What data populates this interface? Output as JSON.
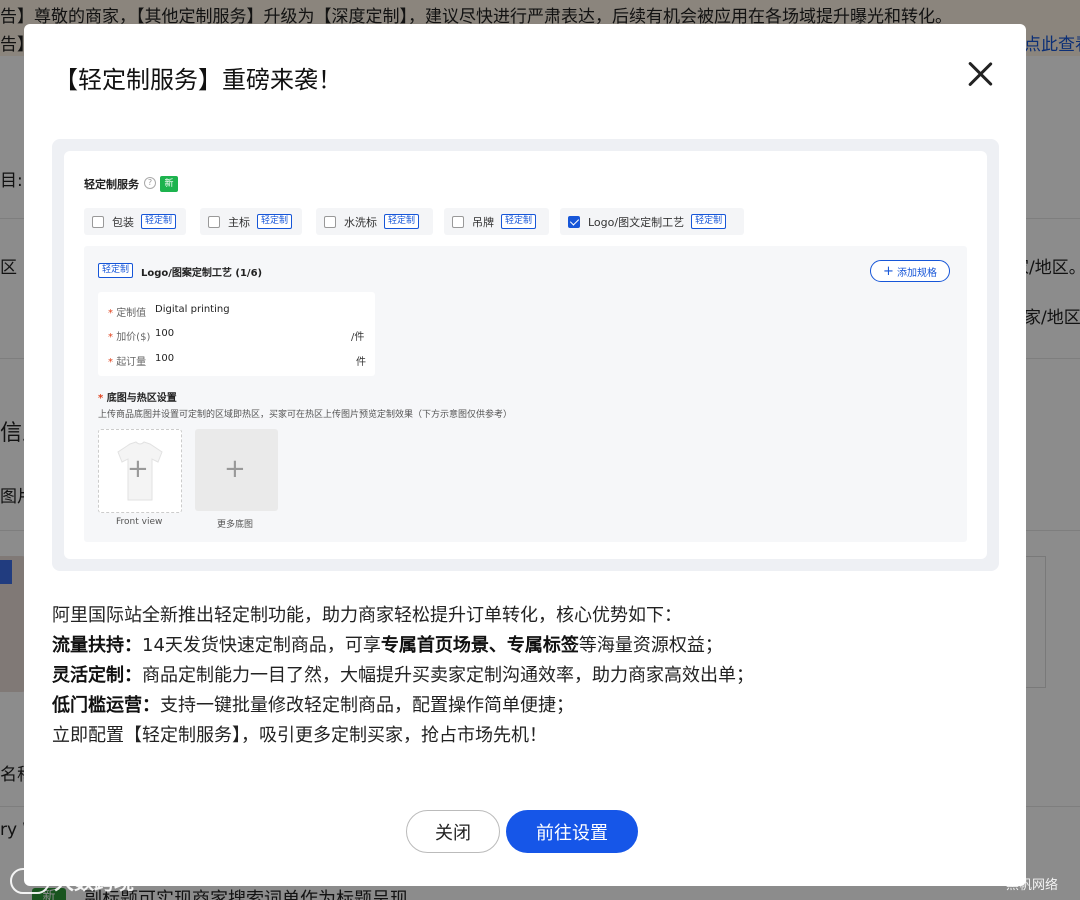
{
  "background": {
    "notice_line1": "告】尊敬的商家，【其他定制服务】升级为【深度定制】，建议尽快进行严肃表达，后续有机会被应用在各场域提升曝光和转化。",
    "notice_line2": "告】",
    "notice_link": "点此查看",
    "frag_1": "目:",
    "frag_2": "区",
    "frag_3": "家/地区。",
    "frag_4": "家/地区",
    "frag_5": "信息",
    "frag_6": "图片",
    "frag_7": "名称",
    "frag_8": "ry W",
    "bottom_badge": "新",
    "bottom_text": "副标题可实现商家搜索词单作为标题呈现"
  },
  "watermark": {
    "left": "大数跨境",
    "right": "黑帆网络"
  },
  "modal": {
    "title": "【轻定制服务】重磅来袭！",
    "preview": {
      "service_label": "轻定制服务",
      "new_badge": "新",
      "tag_text": "轻定制",
      "options": [
        {
          "label": "包装",
          "checked": false
        },
        {
          "label": "主标",
          "checked": false
        },
        {
          "label": "水洗标",
          "checked": false
        },
        {
          "label": "吊牌",
          "checked": false
        },
        {
          "label": "Logo/图文定制工艺",
          "checked": true
        }
      ],
      "panel_title": "Logo/图案定制工艺 (1/6)",
      "add_spec_label": "添加规格",
      "fields": {
        "value_label": "定制值",
        "value": "Digital printing",
        "price_label": "加价($)",
        "price": "100",
        "price_unit": "/件",
        "moq_label": "起订量",
        "moq": "100",
        "moq_unit": "件"
      },
      "hotspot_title": "底图与热区设置",
      "hotspot_desc": "上传商品底图并设置可定制的区域即热区，买家可在热区上传图片预览定制效果（下方示意图仅供参考）",
      "front_caption": "Front view",
      "more_caption": "更多底图"
    },
    "description": {
      "intro": "阿里国际站全新推出轻定制功能，助力商家轻松提升订单转化，核心优势如下：",
      "point1_title": "流量扶持：",
      "point1_a": "14天发货快速定制商品，可享",
      "point1_bold": "专属首页场景、专属标签",
      "point1_b": "等海量资源权益；",
      "point2_title": "灵活定制：",
      "point2_text": "商品定制能力一目了然，大幅提升买卖家定制沟通效率，助力商家高效出单；",
      "point3_title": "低门槛运营：",
      "point3_text": "支持一键批量修改轻定制商品，配置操作简单便捷；",
      "closing": "立即配置【轻定制服务】，吸引更多定制买家，抢占市场先机！"
    },
    "buttons": {
      "close": "关闭",
      "go": "前往设置"
    }
  }
}
